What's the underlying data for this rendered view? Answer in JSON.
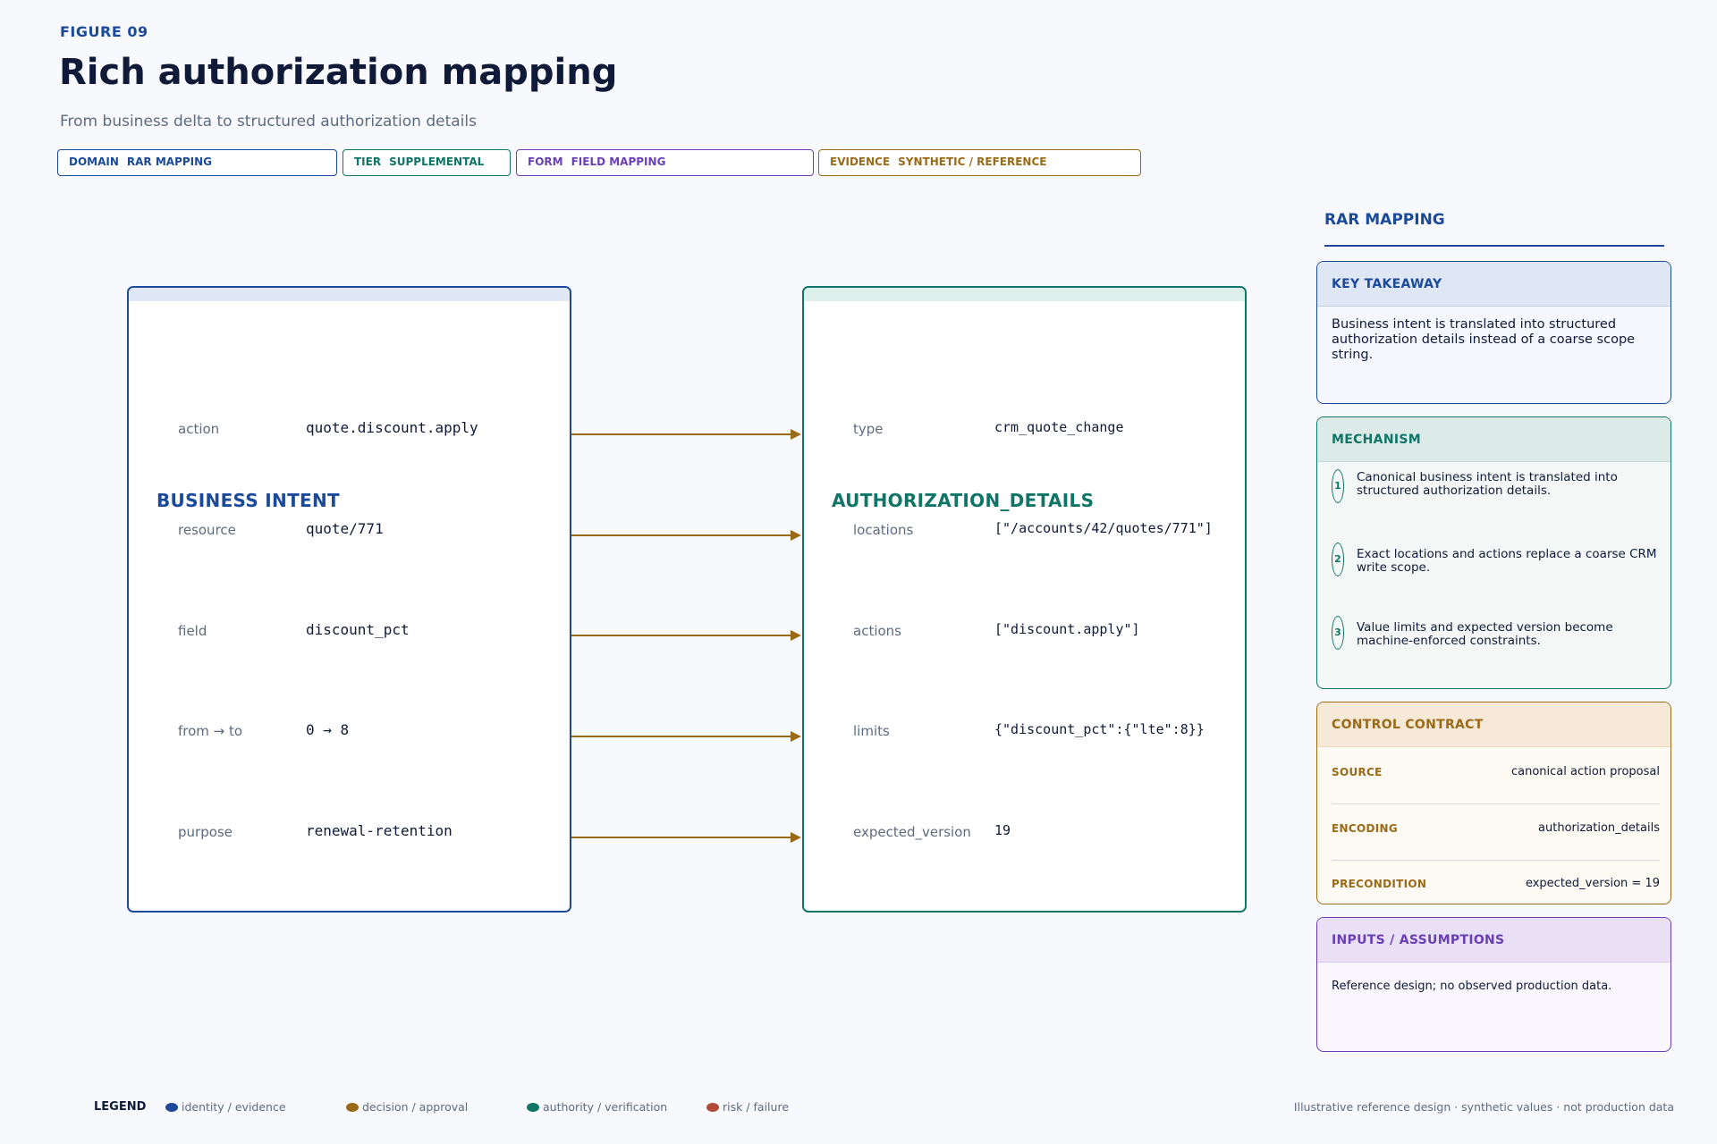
{
  "header": {
    "figure_label": "FIGURE 09",
    "title": "Rich authorization mapping",
    "subtitle": "From business delta to structured authorization details"
  },
  "tags": [
    {
      "key": "DOMAIN",
      "value": "RAR MAPPING",
      "color": "#1a4a99"
    },
    {
      "key": "TIER",
      "value": "SUPPLEMENTAL",
      "color": "#0f7566"
    },
    {
      "key": "FORM",
      "value": "FIELD MAPPING",
      "color": "#6a3fb5"
    },
    {
      "key": "EVIDENCE",
      "value": "SYNTHETIC / REFERENCE",
      "color": "#9a6a17"
    }
  ],
  "business_intent": {
    "title": "BUSINESS INTENT",
    "color": "#1a4a99",
    "strip_color": "#e0e8f7",
    "rows": [
      {
        "label": "action",
        "value": "quote.discount.apply"
      },
      {
        "label": "resource",
        "value": "quote/771"
      },
      {
        "label": "field",
        "value": "discount_pct"
      },
      {
        "label": "from → to",
        "value": "0 → 8"
      },
      {
        "label": "purpose",
        "value": "renewal-retention"
      }
    ]
  },
  "authorization_details": {
    "title": "AUTHORIZATION_DETAILS",
    "color": "#0f7566",
    "strip_color": "#dcefea",
    "rows": [
      {
        "label": "type",
        "value": "crm_quote_change"
      },
      {
        "label": "locations",
        "value": "[\"/accounts/42/quotes/771\"]"
      },
      {
        "label": "actions",
        "value": "[\"discount.apply\"]"
      },
      {
        "label": "limits",
        "value": "{\"discount_pct\":{\"lte\":8}}"
      },
      {
        "label": "expected_version",
        "value": "19"
      }
    ]
  },
  "arrow_color": "#9a6a17",
  "sidebar": {
    "heading": "RAR MAPPING",
    "key_takeaway": {
      "title": "KEY TAKEAWAY",
      "text": "Business intent is translated into structured authorization details instead of a coarse scope string."
    },
    "mechanism": {
      "title": "MECHANISM",
      "steps": [
        {
          "num": "1",
          "text": "Canonical business intent is translated into structured authorization details."
        },
        {
          "num": "2",
          "text": "Exact locations and actions replace a coarse CRM write scope."
        },
        {
          "num": "3",
          "text": "Value limits and expected version become machine-enforced constraints."
        }
      ]
    },
    "control_contract": {
      "title": "CONTROL CONTRACT",
      "rows": [
        {
          "key": "SOURCE",
          "value": "canonical action proposal"
        },
        {
          "key": "ENCODING",
          "value": "authorization_details"
        },
        {
          "key": "PRECONDITION",
          "value": "expected_version = 19"
        }
      ]
    },
    "inputs": {
      "title": "INPUTS / ASSUMPTIONS",
      "text": "Reference design; no observed production data."
    }
  },
  "legend": {
    "label": "LEGEND",
    "items": [
      {
        "label": "identity / evidence",
        "color": "#1a4a99"
      },
      {
        "label": "decision / approval",
        "color": "#9a6a17"
      },
      {
        "label": "authority / verification",
        "color": "#0f7566"
      },
      {
        "label": "risk / failure",
        "color": "#b04a3a"
      }
    ]
  },
  "footer_note": "Illustrative reference design · synthetic values · not production data"
}
